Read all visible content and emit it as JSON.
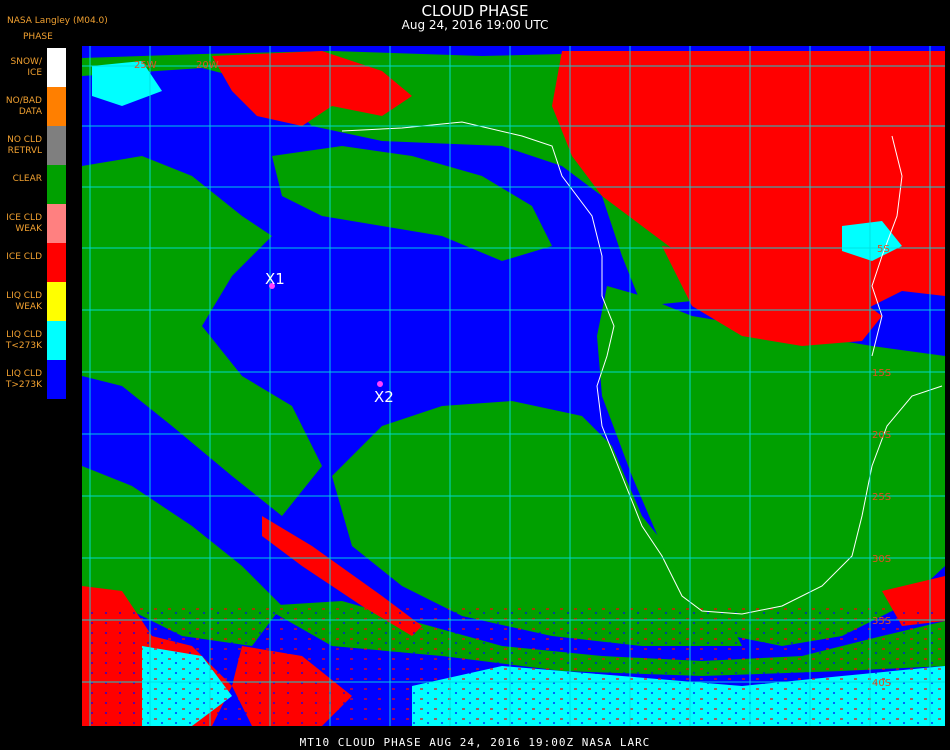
{
  "header": {
    "title": "CLOUD PHASE",
    "subtitle": "Aug 24, 2016 19:00 UTC"
  },
  "brand": "NASA Langley (M04.0)",
  "legend": {
    "title": "PHASE",
    "items": [
      {
        "label": "SNOW/\nICE",
        "color": "#ffffff"
      },
      {
        "label": "NO/BAD\nDATA",
        "color": "#ff7f00"
      },
      {
        "label": "NO CLD\nRETRVL",
        "color": "#7f7f7f"
      },
      {
        "label": "CLEAR",
        "color": "#00a000"
      },
      {
        "label": "ICE CLD\nWEAK",
        "color": "#ff8080"
      },
      {
        "label": "ICE CLD",
        "color": "#ff0000"
      },
      {
        "label": "LIQ CLD\nWEAK",
        "color": "#ffff00"
      },
      {
        "label": "LIQ CLD\nT<273K",
        "color": "#00ffff"
      },
      {
        "label": "LIQ CLD\nT>273K",
        "color": "#0000ff"
      }
    ]
  },
  "map_labels": {
    "lon": [
      "25W",
      "20W"
    ],
    "lat": [
      "5S",
      "15S",
      "20S",
      "25S",
      "30S",
      "35S",
      "40S"
    ],
    "markers": [
      "X1",
      "X2"
    ]
  },
  "footer": "MT10   CLOUD PHASE   AUG 24, 2016 19:00Z   NASA LARC"
}
